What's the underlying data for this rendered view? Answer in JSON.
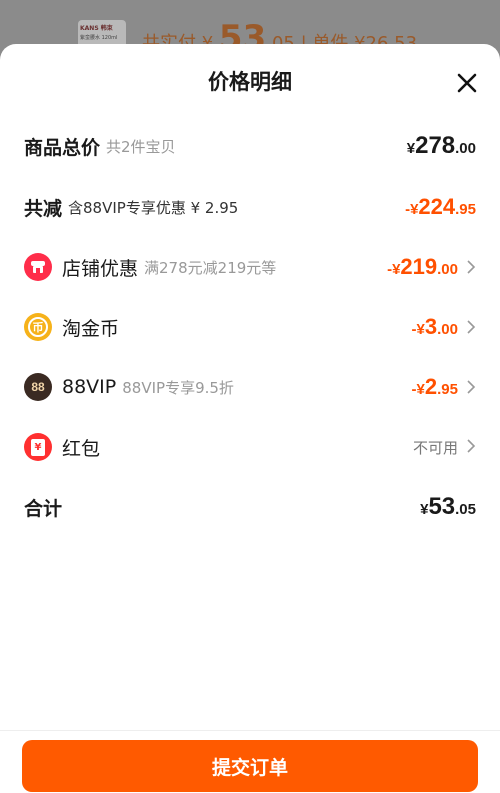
{
  "background": {
    "thumb_brand": "KANS 韩束",
    "thumb_text": "紫蛮腰水 120ml",
    "price_text": "共实付 ¥ ",
    "price_big": "53",
    "price_rest": ".05 | 单件 ¥26.53"
  },
  "sheet": {
    "title": "价格明细"
  },
  "rows": {
    "total": {
      "label": "商品总价",
      "sub": "共2件宝贝",
      "cur": "¥",
      "int": "278",
      "dec": ".00"
    },
    "reduce": {
      "label": "共减",
      "sub": "含88VIP专享优惠 ¥ 2.95",
      "cur": "-¥",
      "int": "224",
      "dec": ".95"
    },
    "shop": {
      "label": "店铺优惠",
      "sub": "满278元减219元等",
      "cur": "-¥",
      "int": "219",
      "dec": ".00"
    },
    "coin": {
      "label": "淘金币",
      "cur": "-¥",
      "int": "3",
      "dec": ".00",
      "icon_text": "币"
    },
    "vip": {
      "label": "88VIP",
      "sub": "88VIP专享9.5折",
      "cur": "-¥",
      "int": "2",
      "dec": ".95",
      "icon_text": "88"
    },
    "redpacket": {
      "label": "红包",
      "status": "不可用",
      "icon_text": "¥"
    },
    "sum": {
      "label": "合计",
      "cur": "¥",
      "int": "53",
      "dec": ".05"
    }
  },
  "footer": {
    "submit_label": "提交订单"
  },
  "colors": {
    "accent": "#ff5000",
    "button": "#ff5a00",
    "shop_icon": "#ff2d4a",
    "coin_icon": "#f6b21a",
    "vip_icon": "#3a2a22",
    "redpacket_icon": "#ff3030"
  },
  "icons": [
    "close-icon",
    "shop-icon",
    "coin-icon",
    "vip-icon",
    "red-packet-icon",
    "chevron-right-icon"
  ]
}
